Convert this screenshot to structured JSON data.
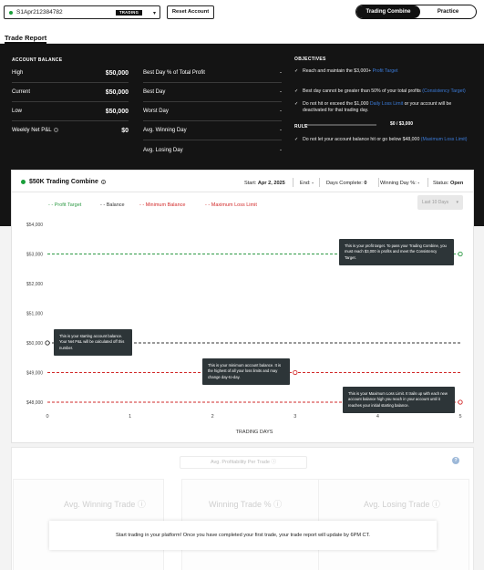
{
  "topbar": {
    "account_id": "S1Apr212384782",
    "account_tag": "TRADING",
    "reset_label": "Reset Account",
    "mode_active": "Trading Combine",
    "mode_inactive": "Practice"
  },
  "page": {
    "title": "Trade Report"
  },
  "account_balance": {
    "heading": "ACCOUNT BALANCE",
    "left": [
      {
        "label": "High",
        "value": "$50,000"
      },
      {
        "label": "Current",
        "value": "$50,000"
      },
      {
        "label": "Low",
        "value": "$50,000"
      },
      {
        "label": "Weekly Net P&L",
        "value": "$0"
      }
    ],
    "right": [
      {
        "label": "Best Day % of Total Profit",
        "value": "-"
      },
      {
        "label": "Best Day",
        "value": "-"
      },
      {
        "label": "Worst Day",
        "value": "-"
      },
      {
        "label": "Avg. Winning Day",
        "value": "-"
      },
      {
        "label": "Avg. Losing Day",
        "value": "-"
      }
    ]
  },
  "objectives": {
    "heading": "OBJECTIVES",
    "o1_text": "Reach and maintain the $3,000+ ",
    "o1_link": "Profit Target",
    "o1_progress": "$0 / $3,000",
    "o1_progress_fraction": 0,
    "o2_text": "Best day cannot be greater than 50% of your total profits ",
    "o2_link": "(Consistency Target)",
    "o3_text_a": "Do not hit or exceed the $1,000 ",
    "o3_link": "Daily Loss Limit",
    "o3_text_b": " or your account will be deactivated for that trading day.",
    "rule_heading": "RULE",
    "r1_text": "Do not let your account balance hit or go below $48,000 ",
    "r1_link": "(Maximum Loss Limit)"
  },
  "combine": {
    "title": "$50K Trading Combine",
    "start_label": "Start: ",
    "start_value": "Apr 2, 2025",
    "end_label": "End: ",
    "end_value": "-",
    "days_label": "Days Complete: ",
    "days_value": "0",
    "winning_label": "Winning Day %: ",
    "winning_value": "-",
    "status_label": "Status: ",
    "status_value": "Open",
    "range_select": "Last 10 Days"
  },
  "legend": {
    "profit": "Profit Target",
    "balance": "Balance",
    "min": "Minimum Balance",
    "max": "Maximum Loss Limit"
  },
  "colors": {
    "profit": "#2e9a45",
    "balance": "#333333",
    "min": "#d22a2a",
    "link": "#3b7bd8"
  },
  "chart_data": {
    "type": "line",
    "xlabel": "TRADING DAYS",
    "ylabel": "",
    "xlim": [
      0,
      5
    ],
    "ylim": [
      48000,
      54000
    ],
    "x_ticks": [
      0,
      1,
      2,
      3,
      4,
      5
    ],
    "y_ticks": [
      "$48,000",
      "$49,000",
      "$50,000",
      "$51,000",
      "$52,000",
      "$53,000",
      "$54,000"
    ],
    "series": [
      {
        "name": "Profit Target",
        "y": 53000,
        "marker_x": 5
      },
      {
        "name": "Balance",
        "y": 50000,
        "marker_x": 0
      },
      {
        "name": "Minimum Balance",
        "y": 49000,
        "marker_x": 3
      },
      {
        "name": "Maximum Loss Limit",
        "y": 48000,
        "marker_x": 5
      }
    ]
  },
  "tooltips": {
    "profit": "This is your profit target. To pass your Trading Combine, you must reach $3,000 in profits and meet the Consistency Target.",
    "balance": "This is your starting account balance. Your Net P&L will be calculated off this number.",
    "min": "This is your minimum account balance. It is the highest of all your loss limits and may change day-to-day.",
    "max": "This is your Maximum Loss Limit. It trails up with each new account balance high you reach in your account until it reaches your initial starting balance."
  },
  "bottom": {
    "avg_profitability": "Avg. Profitability Per Trade",
    "c1": "Avg. Winning Trade",
    "c2": "Winning Trade %",
    "c3": "Avg. Losing Trade",
    "notice": "Start trading in your platform! Once you have completed your first trade, your trade report will update by 6PM CT."
  }
}
